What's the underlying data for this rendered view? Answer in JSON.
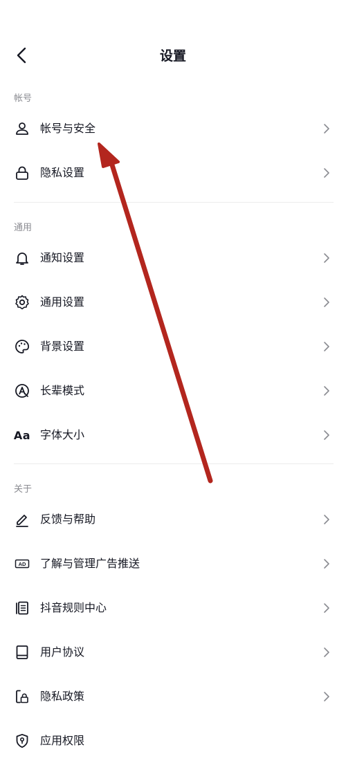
{
  "header": {
    "title": "设置"
  },
  "sections": [
    {
      "label": "帐号"
    },
    {
      "label": "通用"
    },
    {
      "label": "关于"
    }
  ],
  "items": [
    {
      "label": "帐号与安全",
      "icon": "user-icon"
    },
    {
      "label": "隐私设置",
      "icon": "lock-icon"
    },
    {
      "label": "通知设置",
      "icon": "bell-icon"
    },
    {
      "label": "通用设置",
      "icon": "gear-icon"
    },
    {
      "label": "背景设置",
      "icon": "palette-icon"
    },
    {
      "label": "长辈模式",
      "icon": "elder-mode-icon"
    },
    {
      "label": "字体大小",
      "icon": "font-size-icon",
      "icon_text": "Aa"
    },
    {
      "label": "反馈与帮助",
      "icon": "pencil-icon"
    },
    {
      "label": "了解与管理广告推送",
      "icon": "ad-icon",
      "icon_text": "AD"
    },
    {
      "label": "抖音规则中心",
      "icon": "rules-book-icon"
    },
    {
      "label": "用户协议",
      "icon": "agreement-book-icon"
    },
    {
      "label": "隐私政策",
      "icon": "privacy-policy-icon"
    },
    {
      "label": "应用权限",
      "icon": "shield-icon"
    }
  ],
  "annotation": {
    "color": "#b3261e",
    "points_to": "帐号与安全"
  }
}
